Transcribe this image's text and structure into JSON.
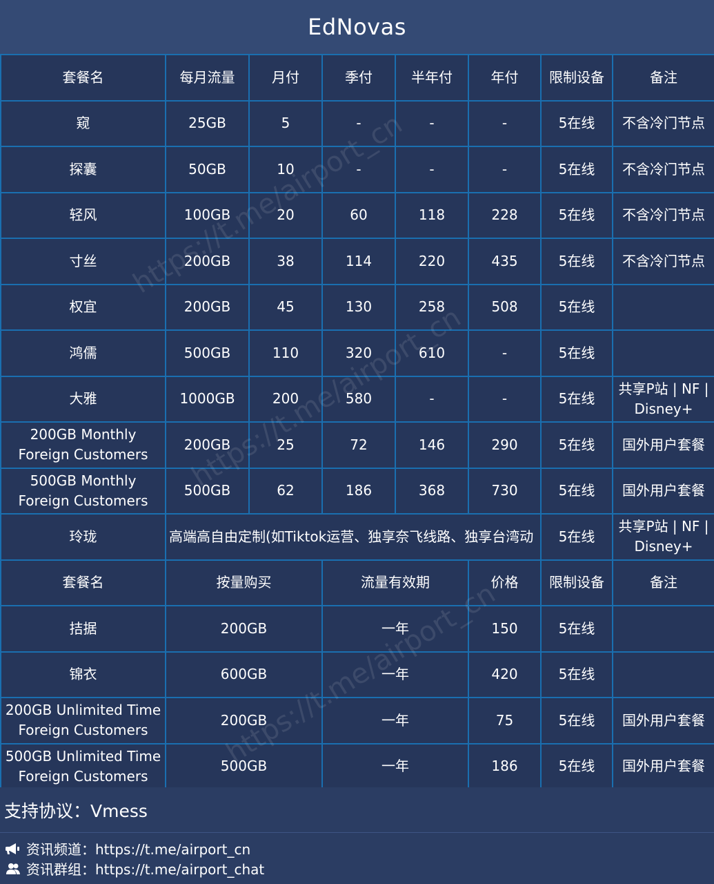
{
  "header": {
    "title": "EdNovas"
  },
  "table1": {
    "columns": [
      "套餐名",
      "每月流量",
      "月付",
      "季付",
      "半年付",
      "年付",
      "限制设备",
      "备注"
    ],
    "rows": [
      {
        "name": "窥",
        "traffic": "25GB",
        "monthly": "5",
        "quarterly": "-",
        "half_year": "-",
        "yearly": "-",
        "devices": "5在线",
        "note": "不含冷门节点"
      },
      {
        "name": "探囊",
        "traffic": "50GB",
        "monthly": "10",
        "quarterly": "-",
        "half_year": "-",
        "yearly": "-",
        "devices": "5在线",
        "note": "不含冷门节点"
      },
      {
        "name": "轻风",
        "traffic": "100GB",
        "monthly": "20",
        "quarterly": "60",
        "half_year": "118",
        "yearly": "228",
        "devices": "5在线",
        "note": "不含冷门节点"
      },
      {
        "name": "寸丝",
        "traffic": "200GB",
        "monthly": "38",
        "quarterly": "114",
        "half_year": "220",
        "yearly": "435",
        "devices": "5在线",
        "note": "不含冷门节点"
      },
      {
        "name": "权宜",
        "traffic": "200GB",
        "monthly": "45",
        "quarterly": "130",
        "half_year": "258",
        "yearly": "508",
        "devices": "5在线",
        "note": ""
      },
      {
        "name": "鸿儒",
        "traffic": "500GB",
        "monthly": "110",
        "quarterly": "320",
        "half_year": "610",
        "yearly": "-",
        "devices": "5在线",
        "note": ""
      },
      {
        "name": "大雅",
        "traffic": "1000GB",
        "monthly": "200",
        "quarterly": "580",
        "half_year": "-",
        "yearly": "-",
        "devices": "5在线",
        "note": "共享P站 | NF | Disney+"
      },
      {
        "name": "200GB Monthly Foreign Customers",
        "traffic": "200GB",
        "monthly": "25",
        "quarterly": "72",
        "half_year": "146",
        "yearly": "290",
        "devices": "5在线",
        "note": "国外用户套餐"
      },
      {
        "name": "500GB Monthly Foreign Customers",
        "traffic": "500GB",
        "monthly": "62",
        "quarterly": "186",
        "half_year": "368",
        "yearly": "730",
        "devices": "5在线",
        "note": "国外用户套餐"
      }
    ],
    "custom_row": {
      "name": "玲珑",
      "description": "高端高自由定制(如Tiktok运营、独享奈飞线路、独享台湾动",
      "devices": "5在线",
      "note": "共享P站 | NF | Disney+"
    }
  },
  "table2": {
    "columns": [
      "套餐名",
      "按量购买",
      "流量有效期",
      "价格",
      "限制设备",
      "备注"
    ],
    "rows": [
      {
        "name": "拮据",
        "amount": "200GB",
        "validity": "一年",
        "price": "150",
        "devices": "5在线",
        "note": ""
      },
      {
        "name": "锦衣",
        "amount": "600GB",
        "validity": "一年",
        "price": "420",
        "devices": "5在线",
        "note": ""
      },
      {
        "name": "200GB Unlimited Time Foreign Customers",
        "amount": "200GB",
        "validity": "一年",
        "price": "75",
        "devices": "5在线",
        "note": "国外用户套餐"
      },
      {
        "name": "500GB Unlimited Time Foreign Customers",
        "amount": "500GB",
        "validity": "一年",
        "price": "186",
        "devices": "5在线",
        "note": "国外用户套餐"
      }
    ]
  },
  "footer": {
    "protocol": "支持协议：Vmess",
    "channel": {
      "icon": "megaphone-icon",
      "text": "资讯频道：https://t.me/airport_cn"
    },
    "group": {
      "icon": "users-icon",
      "text": "资讯群组：https://t.me/airport_chat"
    }
  },
  "watermark": "https://t.me/airport_cn",
  "colors": {
    "background": "#26365a",
    "header": "#344a74",
    "border": "#1a6fb0",
    "text": "#ffffff"
  }
}
